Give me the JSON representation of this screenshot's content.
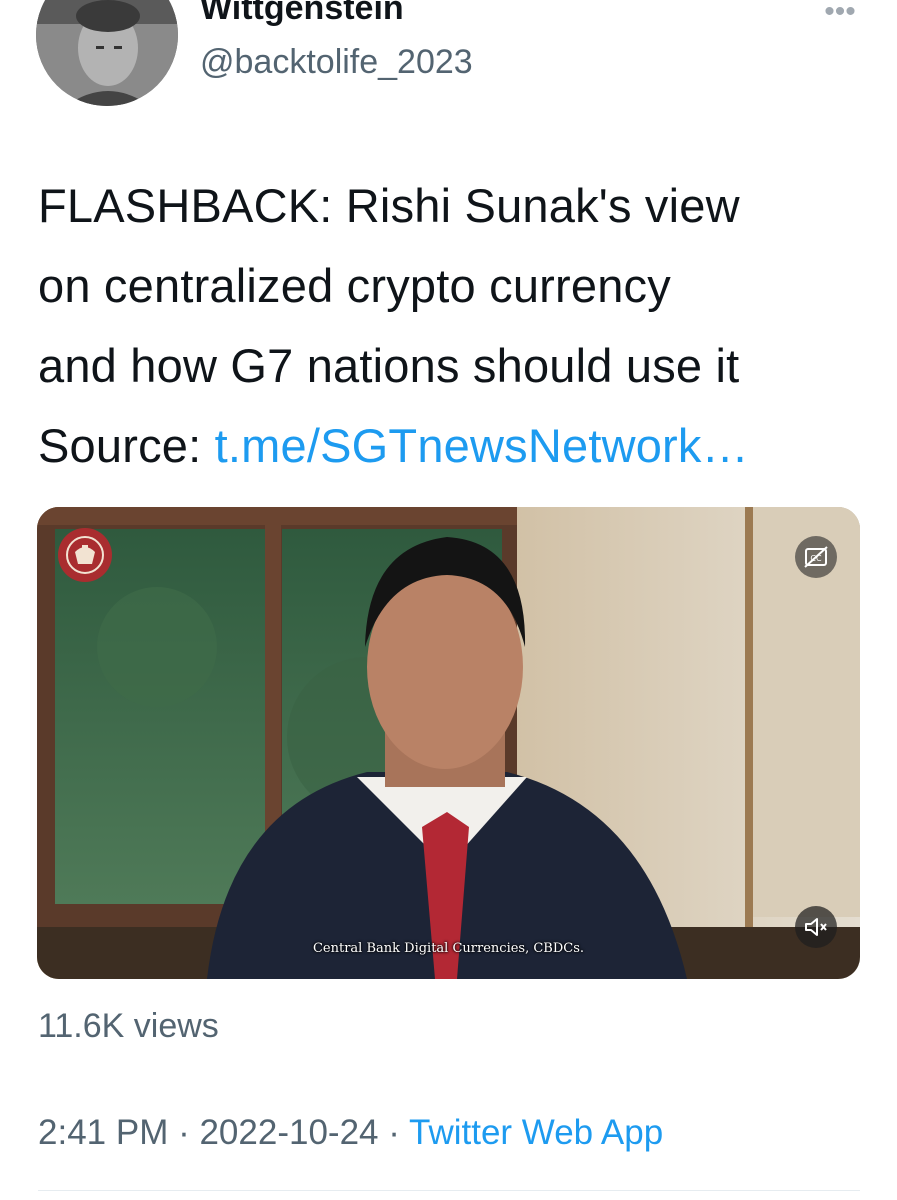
{
  "author": {
    "display_name": "Wittgenstein",
    "handle": "@backtolife_2023",
    "avatar_icon": "profile-photo"
  },
  "more_icon": "more-dots-icon",
  "tweet": {
    "line1": "FLASHBACK: Rishi Sunak's view",
    "line2": "on centralized crypto currency",
    "line3": "and how G7 nations should use it",
    "source_label": "Source: ",
    "link_text": "t.me/SGTnewsNetwork…"
  },
  "video": {
    "caption": "Central Bank Digital Currencies, CBDCs.",
    "cc_icon": "closed-captions-icon",
    "mute_icon": "volume-muted-icon",
    "crest_icon": "royal-crest-icon"
  },
  "views": "11.6K views",
  "meta": {
    "time": "2:41 PM",
    "separator": " · ",
    "date": "2022-10-24",
    "source_app": "Twitter Web App"
  },
  "colors": {
    "link": "#1d9bf0",
    "secondary_text": "#536471",
    "primary_text": "#0f1419"
  }
}
